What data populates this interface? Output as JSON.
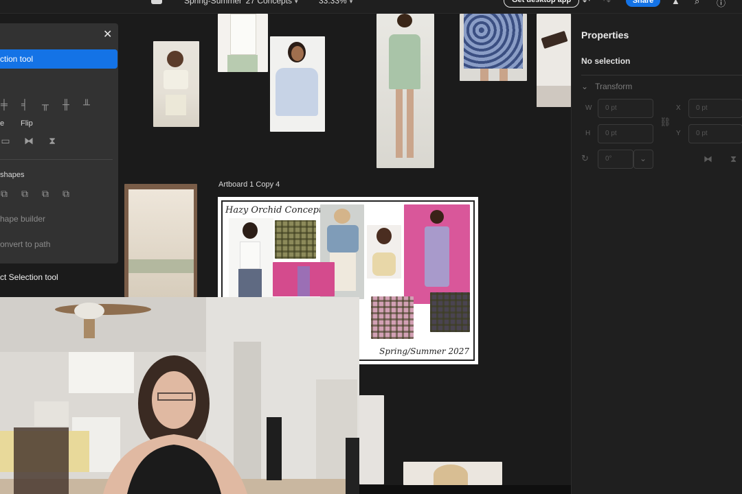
{
  "topbar": {
    "document_title": "Spring-Summer '27 Concepts",
    "zoom": "33.33%",
    "desktop_button": "Get desktop app",
    "share_button": "Share"
  },
  "left_panel": {
    "selected_tool": "ction tool",
    "flip_label": "Flip",
    "side_label": "e",
    "shapes_label": "shapes",
    "shape_builder": "hape builder",
    "convert_to_path": "onvert to path",
    "direct_selection": "ct Selection tool"
  },
  "canvas": {
    "artboard_label": "Artboard 1 Copy 4",
    "artboard_title": "Hazy Orchid Concept",
    "artboard_footer": "Spring/Summer 2027"
  },
  "properties": {
    "title": "Properties",
    "selection_status": "No selection",
    "transform_label": "Transform",
    "w_label": "W",
    "h_label": "H",
    "x_label": "X",
    "y_label": "Y",
    "w_value": "0 pt",
    "h_value": "0 pt",
    "x_value": "0 pt",
    "y_value": "0 pt",
    "rotate_value": "0°"
  },
  "colors": {
    "accent": "#1473e6",
    "canvas_bg": "#1b1b1b",
    "panel_bg": "#323232"
  }
}
